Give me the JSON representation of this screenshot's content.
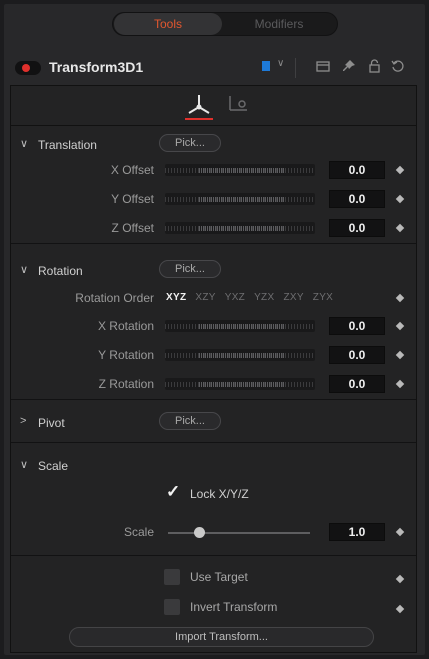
{
  "tabs": {
    "tools": "Tools",
    "modifiers": "Modifiers"
  },
  "tool": {
    "name": "Transform3D1",
    "color_chip": "#1e7ad8",
    "enabled_color": "#e0302c"
  },
  "title_icons": [
    "color-dropdown-chevron",
    "window-icon",
    "pin-icon",
    "lock-icon",
    "reset-icon"
  ],
  "subtabs": [
    {
      "icon": "transform-3d-icon",
      "active": true
    },
    {
      "icon": "settings-icon",
      "active": false
    }
  ],
  "translation": {
    "title": "Translation",
    "pick": "Pick...",
    "params": [
      {
        "label": "X Offset",
        "value": "0.0"
      },
      {
        "label": "Y Offset",
        "value": "0.0"
      },
      {
        "label": "Z Offset",
        "value": "0.0"
      }
    ]
  },
  "rotation": {
    "title": "Rotation",
    "pick": "Pick...",
    "order_label": "Rotation Order",
    "orders": [
      "XYZ",
      "XZY",
      "YXZ",
      "YZX",
      "ZXY",
      "ZYX"
    ],
    "selected_order": "XYZ",
    "params": [
      {
        "label": "X Rotation",
        "value": "0.0"
      },
      {
        "label": "Y Rotation",
        "value": "0.0"
      },
      {
        "label": "Z Rotation",
        "value": "0.0"
      }
    ]
  },
  "pivot": {
    "title": "Pivot",
    "pick": "Pick..."
  },
  "scale": {
    "title": "Scale",
    "lock_label": "Lock X/Y/Z",
    "lock_checked": true,
    "label": "Scale",
    "value": "1.0"
  },
  "options": {
    "use_target": "Use Target",
    "use_target_checked": false,
    "invert_transform": "Invert Transform",
    "invert_checked": false
  },
  "import_button": "Import Transform..."
}
